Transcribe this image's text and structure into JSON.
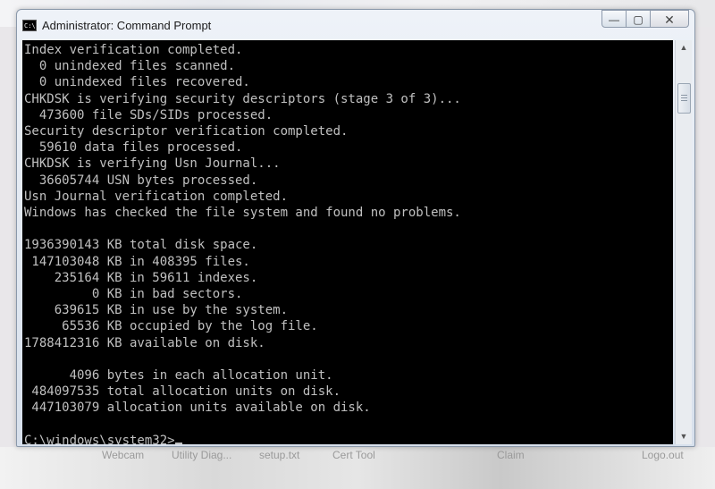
{
  "window": {
    "title": "Administrator: Command Prompt",
    "icon_label": "C:\\",
    "minimize": "—",
    "maximize": "▢",
    "close": "✕"
  },
  "console": {
    "lines": [
      "Index verification completed.",
      "  0 unindexed files scanned.",
      "  0 unindexed files recovered.",
      "CHKDSK is verifying security descriptors (stage 3 of 3)...",
      "  473600 file SDs/SIDs processed.",
      "Security descriptor verification completed.",
      "  59610 data files processed.",
      "CHKDSK is verifying Usn Journal...",
      "  36605744 USN bytes processed.",
      "Usn Journal verification completed.",
      "Windows has checked the file system and found no problems.",
      "",
      "1936390143 KB total disk space.",
      " 147103048 KB in 408395 files.",
      "    235164 KB in 59611 indexes.",
      "         0 KB in bad sectors.",
      "    639615 KB in use by the system.",
      "     65536 KB occupied by the log file.",
      "1788412316 KB available on disk.",
      "",
      "      4096 bytes in each allocation unit.",
      " 484097535 total allocation units on disk.",
      " 447103079 allocation units available on disk.",
      "",
      "C:\\windows\\system32>"
    ]
  },
  "scrollbar": {
    "up_arrow": "▲",
    "down_arrow": "▼"
  },
  "taskbar_labels": [
    "Webcam",
    "Utility Diag...",
    "setup.txt",
    "Cert Tool",
    "Claim",
    "Logo.out"
  ]
}
